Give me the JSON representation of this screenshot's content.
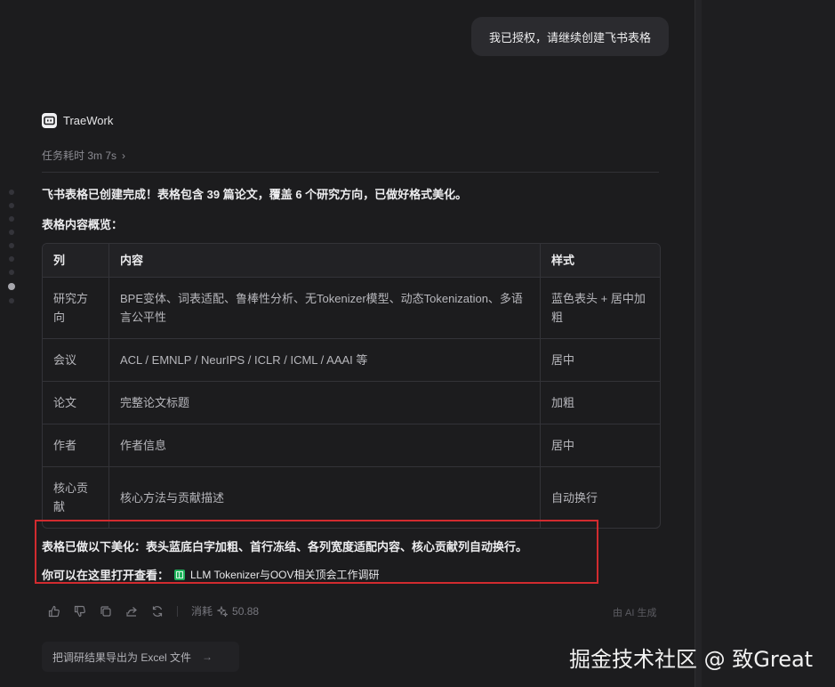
{
  "user_message": "我已授权，请继续创建飞书表格",
  "agent": {
    "name": "TraeWork",
    "logo_icon": "trae-logo-icon"
  },
  "task": {
    "elapsed_label": "任务耗时 3m 7s",
    "chevron": "›"
  },
  "message": {
    "summary_prefix": "飞书表格已创建完成！表格包含 ",
    "paper_count": "39 篇论文",
    "summary_mid": "，覆盖 6 个研究方向，已做好格式美化。",
    "overview_heading": "表格内容概览：",
    "table": {
      "headers": [
        "列",
        "内容",
        "样式"
      ],
      "rows": [
        [
          "研究方向",
          "BPE变体、词表适配、鲁棒性分析、无Tokenizer模型、动态Tokenization、多语言公平性",
          "蓝色表头 + 居中加粗"
        ],
        [
          "会议",
          "ACL / EMNLP / NeurIPS / ICLR / ICML / AAAI 等",
          "居中"
        ],
        [
          "论文",
          "完整论文标题",
          "加粗"
        ],
        [
          "作者",
          "作者信息",
          "居中"
        ],
        [
          "核心贡献",
          "核心方法与贡献描述",
          "自动换行"
        ]
      ]
    },
    "styling_note": "表格已做以下美化：表头蓝底白字加粗、首行冻结、各列宽度适配内容、核心贡献列自动换行。",
    "open_label": "你可以在这里打开查看：",
    "doc_link": "LLM Tokenizer与OOV相关顶会工作调研",
    "doc_icon": "sheet-icon"
  },
  "actions": {
    "icons": [
      "thumbs-up-icon",
      "thumbs-down-icon",
      "copy-icon",
      "share-icon",
      "regenerate-icon"
    ],
    "cost_label": "消耗",
    "cost_value": "50.88",
    "ai_generated": "由 AI 生成"
  },
  "suggestion": {
    "label": "把调研结果导出为 Excel 文件",
    "arrow": "→"
  },
  "watermark": "掘金技术社区 @ 致Great"
}
